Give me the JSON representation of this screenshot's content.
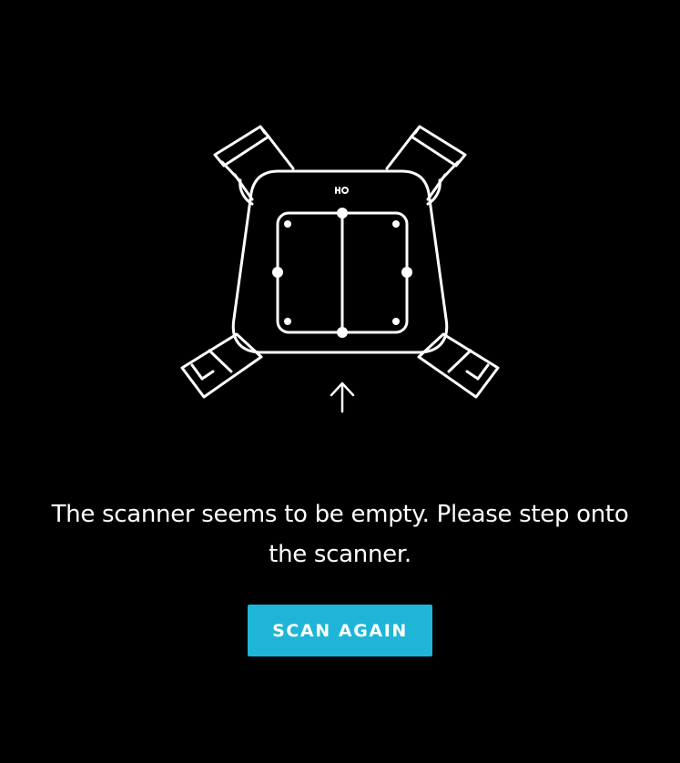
{
  "illustration": {
    "icon": "scanner-platform-icon",
    "stroke_color": "#ffffff"
  },
  "message": {
    "text": "The scanner seems to be empty. Please step onto the scanner."
  },
  "actions": {
    "scan_again_label": "SCAN AGAIN",
    "button_color": "#1fb5d6"
  }
}
